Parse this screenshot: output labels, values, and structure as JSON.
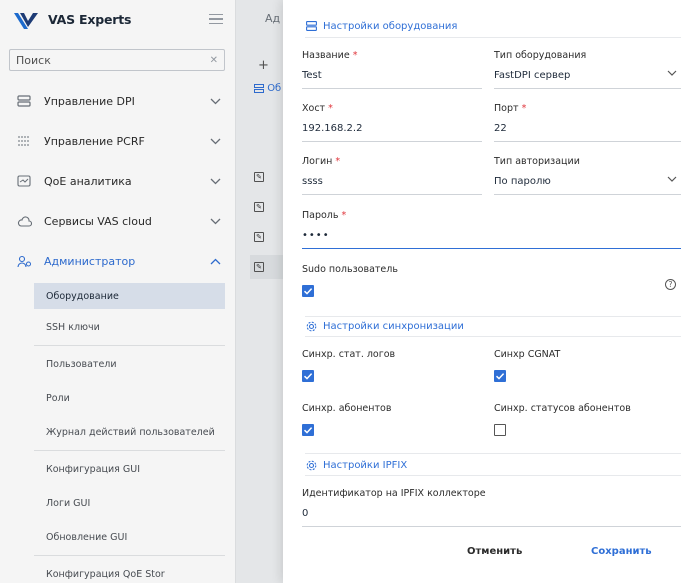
{
  "sidebar": {
    "logo": "VAS Experts",
    "search_placeholder": "Поиск",
    "items": [
      {
        "label": "Управление DPI"
      },
      {
        "label": "Управление PCRF"
      },
      {
        "label": "QoE аналитика"
      },
      {
        "label": "Сервисы VAS cloud"
      },
      {
        "label": "Администратор"
      }
    ],
    "subitems": [
      {
        "label": "Оборудование"
      },
      {
        "label": "SSH ключи"
      },
      {
        "label": "Пользователи"
      },
      {
        "label": "Роли"
      },
      {
        "label": "Журнал действий пользователей"
      },
      {
        "label": "Конфигурация GUI"
      },
      {
        "label": "Логи GUI"
      },
      {
        "label": "Обновление GUI"
      },
      {
        "label": "Конфигурация QoE Stor"
      }
    ]
  },
  "main": {
    "tab_label": "Ад",
    "plus": "+",
    "eq_label": "Об"
  },
  "drawer": {
    "equipment_section": "Настройки оборудования",
    "name_label": "Название",
    "name_value": "Test",
    "type_label": "Тип оборудования",
    "type_value": "FastDPI сервер",
    "host_label": "Хост",
    "host_value": "192.168.2.2",
    "port_label": "Порт",
    "port_value": "22",
    "login_label": "Логин",
    "login_value": "ssss",
    "auth_label": "Тип авторизации",
    "auth_value": "По паролю",
    "password_label": "Пароль",
    "password_value": "••••",
    "sudo_label": "Sudo пользователь",
    "sync_section": "Настройки синхронизации",
    "sync_stat_label": "Синхр. стат. логов",
    "sync_cgnat_label": "Синхр CGNAT",
    "sync_subs_label": "Синхр. абонентов",
    "sync_subs_status_label": "Синхр. статусов абонентов",
    "ipfix_section": "Настройки IPFIX",
    "ipfix_id_label": "Идентификатор на IPFIX коллекторе",
    "ipfix_id_value": "0",
    "cancel_label": "Отменить",
    "save_label": "Сохранить",
    "required_mark": "*",
    "help_mark": "?"
  },
  "colors": {
    "accent": "#2f6fd6",
    "required": "#e0353b"
  }
}
